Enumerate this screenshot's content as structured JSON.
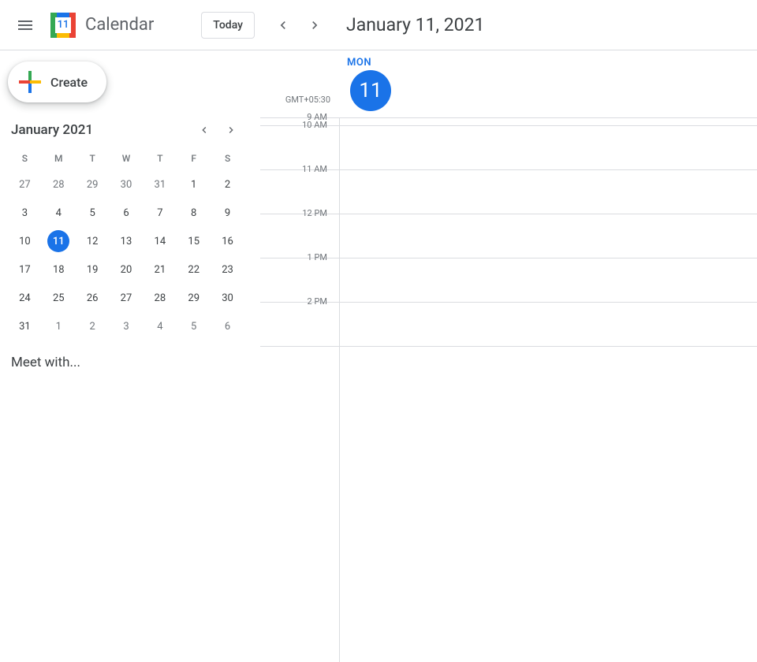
{
  "header": {
    "app_title": "Calendar",
    "today_label": "Today",
    "date_label": "January 11, 2021"
  },
  "sidebar": {
    "create_label": "Create",
    "mini_cal": {
      "title": "January 2021",
      "dow": [
        "S",
        "M",
        "T",
        "W",
        "T",
        "F",
        "S"
      ],
      "weeks": [
        [
          {
            "n": "27",
            "o": true
          },
          {
            "n": "28",
            "o": true
          },
          {
            "n": "29",
            "o": true
          },
          {
            "n": "30",
            "o": true
          },
          {
            "n": "31",
            "o": true
          },
          {
            "n": "1"
          },
          {
            "n": "2"
          }
        ],
        [
          {
            "n": "3"
          },
          {
            "n": "4"
          },
          {
            "n": "5"
          },
          {
            "n": "6"
          },
          {
            "n": "7"
          },
          {
            "n": "8"
          },
          {
            "n": "9"
          }
        ],
        [
          {
            "n": "10"
          },
          {
            "n": "11",
            "sel": true
          },
          {
            "n": "12"
          },
          {
            "n": "13"
          },
          {
            "n": "14"
          },
          {
            "n": "15"
          },
          {
            "n": "16"
          }
        ],
        [
          {
            "n": "17"
          },
          {
            "n": "18"
          },
          {
            "n": "19"
          },
          {
            "n": "20"
          },
          {
            "n": "21"
          },
          {
            "n": "22"
          },
          {
            "n": "23"
          }
        ],
        [
          {
            "n": "24"
          },
          {
            "n": "25"
          },
          {
            "n": "26"
          },
          {
            "n": "27"
          },
          {
            "n": "28"
          },
          {
            "n": "29"
          },
          {
            "n": "30"
          }
        ],
        [
          {
            "n": "31"
          },
          {
            "n": "1",
            "o": true
          },
          {
            "n": "2",
            "o": true
          },
          {
            "n": "3",
            "o": true
          },
          {
            "n": "4",
            "o": true
          },
          {
            "n": "5",
            "o": true
          },
          {
            "n": "6",
            "o": true
          }
        ]
      ]
    },
    "meet_with": "Meet with..."
  },
  "day_view": {
    "dow": "MON",
    "day_num": "11",
    "timezone": "GMT+05:30",
    "hours": [
      "9 AM",
      "10 AM",
      "11 AM",
      "12 PM",
      "1 PM",
      "2 PM"
    ]
  },
  "logo_day": "11"
}
